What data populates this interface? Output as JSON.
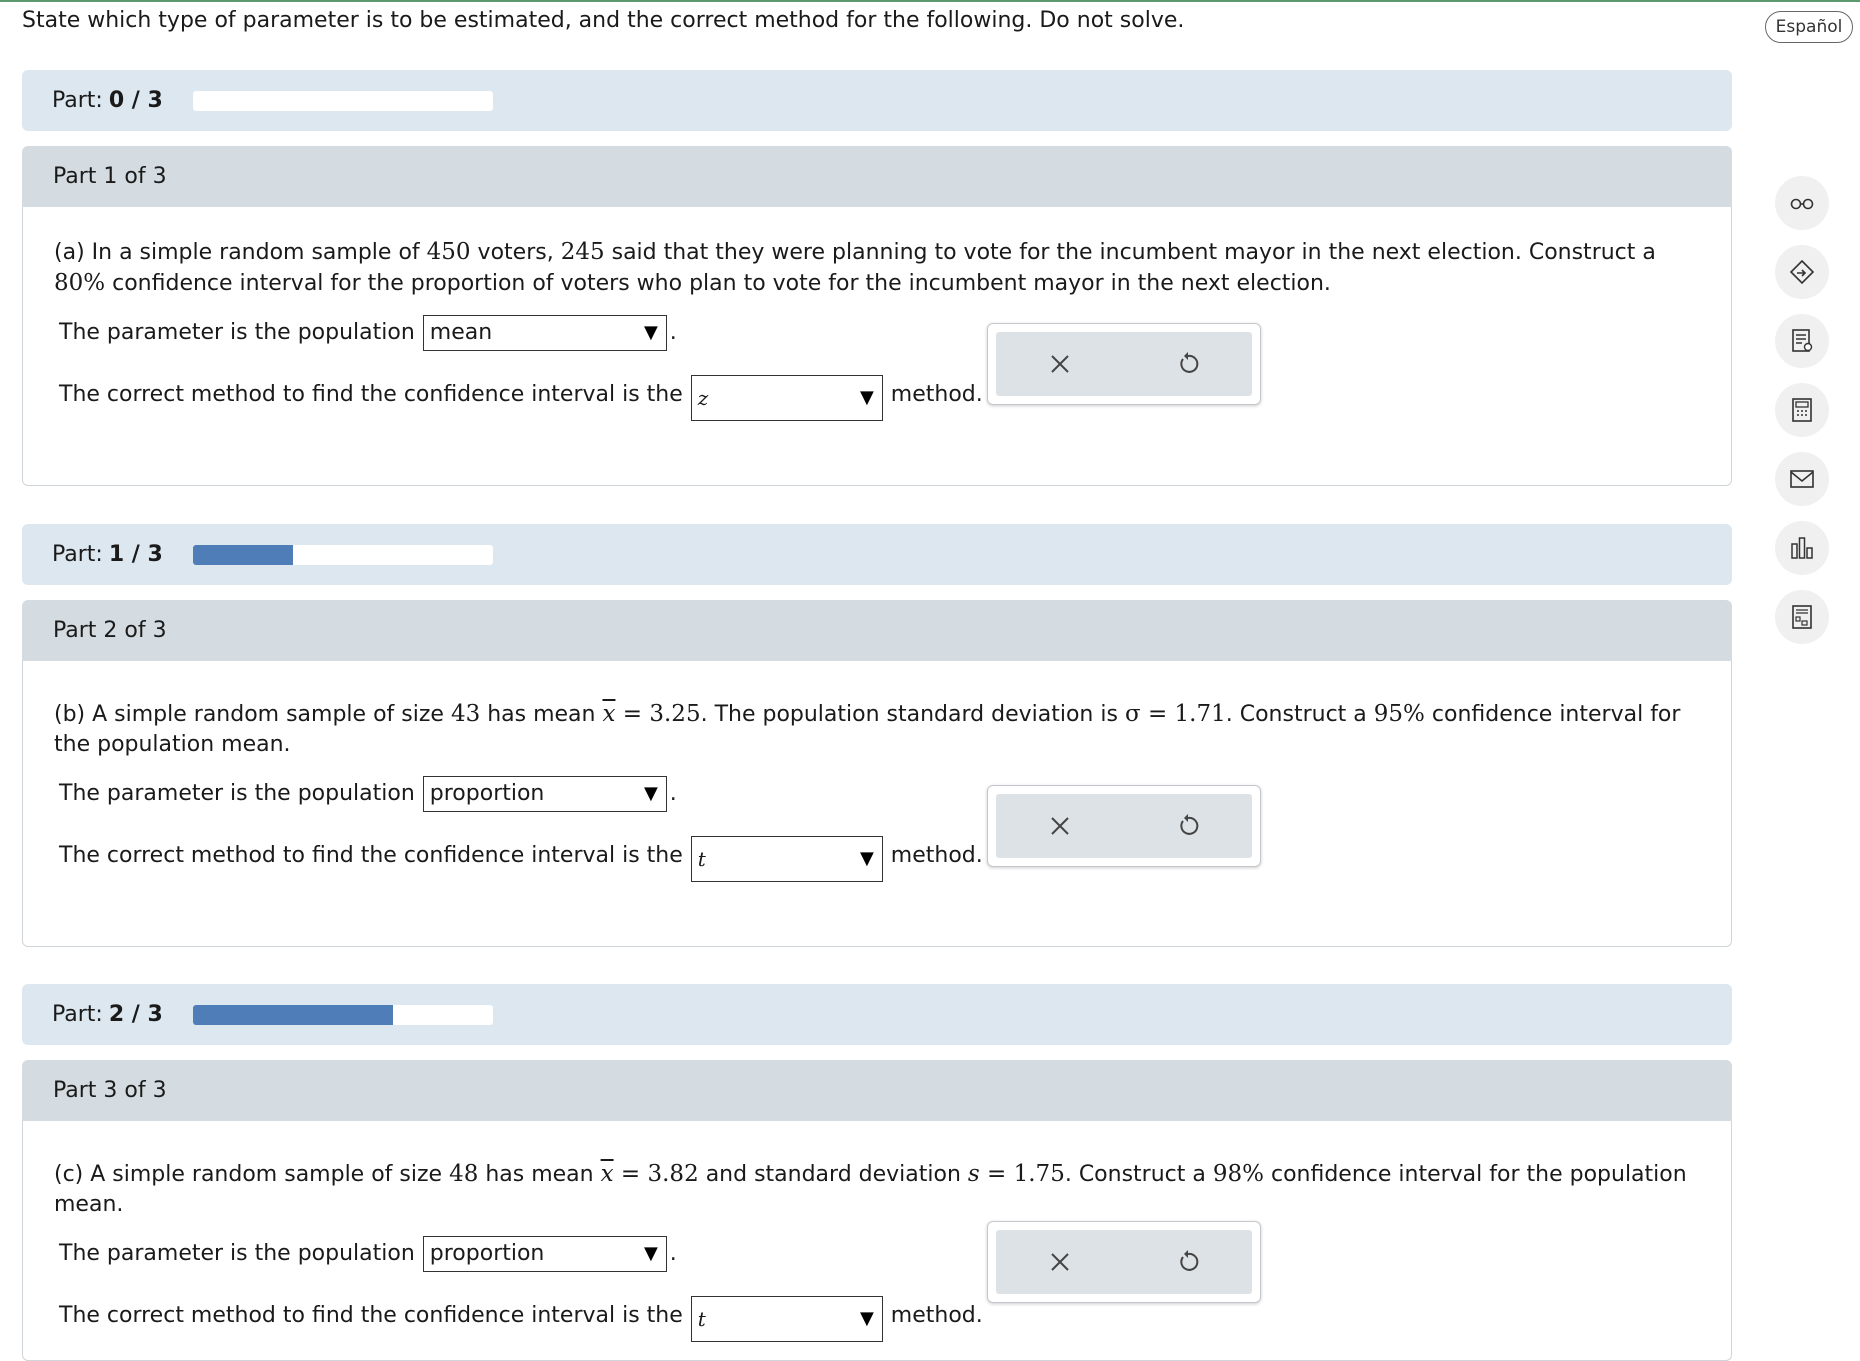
{
  "instruction": "State which type of parameter is to be estimated, and the correct method for the following. Do not solve.",
  "language_button": "Español",
  "colors": {
    "progress_bg": "#dde7f0",
    "progress_fill": "#4f7db7",
    "part_header_bg": "#d5dce1",
    "action_bg": "#dde2e6"
  },
  "tools": [
    "glasses-icon",
    "tag-arrow-icon",
    "notes-icon",
    "calculator-icon",
    "mail-icon",
    "bar-chart-icon",
    "worksheet-icon"
  ],
  "parts": [
    {
      "progress_label": "Part:",
      "progress_value": "0 / 3",
      "progress_fraction": 0,
      "header": "Part 1 of 3",
      "question": {
        "t1": "(a) In a simple random sample of ",
        "n": "450",
        "t2": " voters, ",
        "k": "245",
        "t3": " said that they were planning to vote for the incumbent mayor in the next election. Construct a ",
        "c": "80%",
        "t4": " confidence interval for the proportion of voters who plan to vote for the incumbent mayor in the next election."
      },
      "param_prefix": "The parameter is the population",
      "param_value": "mean",
      "method_prefix": "The correct method to find the confidence interval is the",
      "method_value": "z",
      "method_suffix": "method."
    },
    {
      "progress_label": "Part:",
      "progress_value": "1 / 3",
      "progress_fraction": 0.333,
      "header": "Part 2 of 3",
      "question": {
        "t1": "(b) A simple random sample of size ",
        "n": "43",
        "t2": " has mean ",
        "var1": "x",
        "eq1": " = 3.25",
        "t3": ". The population standard deviation is ",
        "eq2": "σ = 1.71",
        "t4": ". Construct a ",
        "c": "95%",
        "t5": " confidence interval for the population mean."
      },
      "param_prefix": "The parameter is the population",
      "param_value": "proportion",
      "method_prefix": "The correct method to find the confidence interval is the",
      "method_value": "t",
      "method_suffix": "method."
    },
    {
      "progress_label": "Part:",
      "progress_value": "2 / 3",
      "progress_fraction": 0.667,
      "header": "Part 3 of 3",
      "question": {
        "t1": "(c) A simple random sample of size ",
        "n": "48",
        "t2": " has mean ",
        "var1": "x",
        "eq1": " = 3.82",
        "t3": " and standard deviation ",
        "var2": "s",
        "eq2": " = 1.75",
        "t4": ". Construct a ",
        "c": "98%",
        "t5": " confidence interval for the population mean."
      },
      "param_prefix": "The parameter is the population",
      "param_value": "proportion",
      "method_prefix": "The correct method to find the confidence interval is the",
      "method_value": "t",
      "method_suffix": "method."
    }
  ]
}
